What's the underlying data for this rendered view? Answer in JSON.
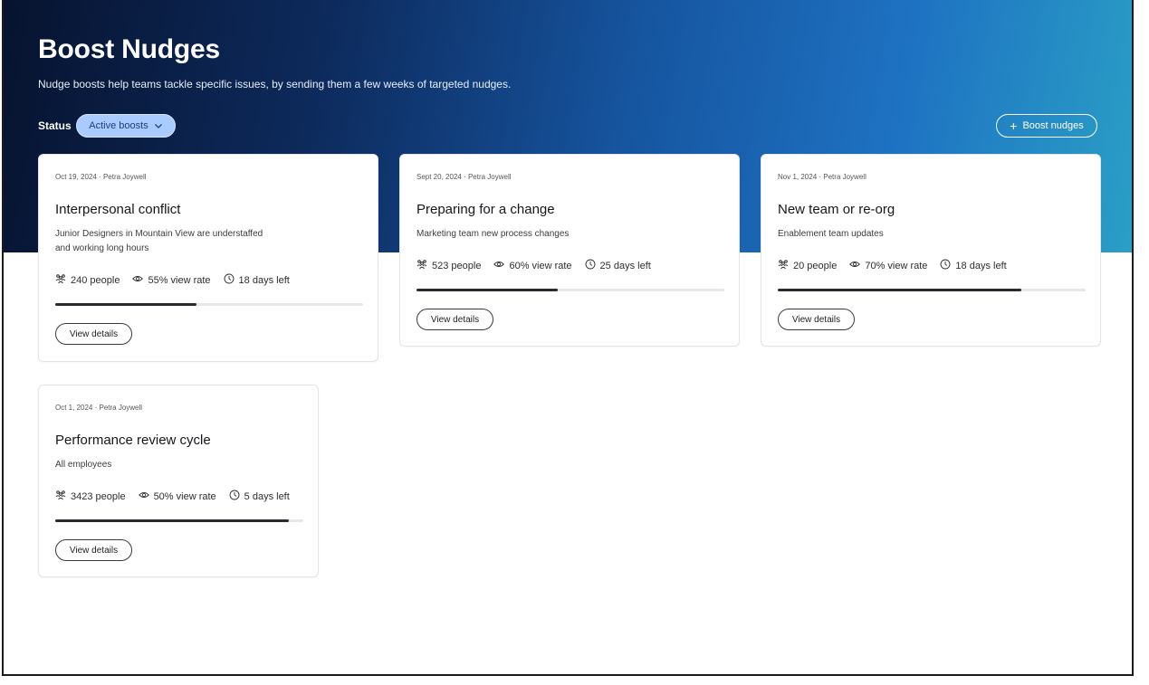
{
  "header": {
    "title": "Boost Nudges",
    "subtitle": "Nudge boosts help teams tackle specific issues, by sending them a few weeks of targeted nudges.",
    "status_label": "Status",
    "status_filter": "Active boosts",
    "boost_button": "Boost nudges"
  },
  "colors": {
    "hero_start": "#07132f",
    "hero_end": "#2a9fc6",
    "filter_pill": "#a9cbff",
    "progress_fill": "#2a2b30"
  },
  "cards": [
    {
      "date": "Oct 19, 2024",
      "author": "Petra Joywell",
      "title": "Interpersonal conflict",
      "description_lines": [
        "Junior Designers in Mountain View are understaffed",
        "and working long hours"
      ],
      "people": "240 people",
      "view_rate": "55% view rate",
      "days_left": "18 days left",
      "progress": 0.46,
      "button": "View details"
    },
    {
      "date": "Sept 20, 2024",
      "author": "Petra Joywell",
      "title": "Preparing for a change",
      "description_lines": [
        "Marketing team new process changes"
      ],
      "people": "523 people",
      "view_rate": "60% view rate",
      "days_left": "25 days left",
      "progress": 0.46,
      "button": "View details"
    },
    {
      "date": "Nov 1, 2024",
      "author": "Petra Joywell",
      "title": "New team or re-org",
      "description_lines": [
        "Enablement team updates"
      ],
      "people": "20 people",
      "view_rate": "70% view rate",
      "days_left": "18 days left",
      "progress": 0.79,
      "button": "View details"
    },
    {
      "date": "Oct 1, 2024",
      "author": "Petra Joywell",
      "title": "Performance review cycle",
      "description_lines": [
        "All employees"
      ],
      "people": "3423 people",
      "view_rate": "50% view rate",
      "days_left": "5 days left",
      "progress": 0.94,
      "button": "View details"
    }
  ]
}
